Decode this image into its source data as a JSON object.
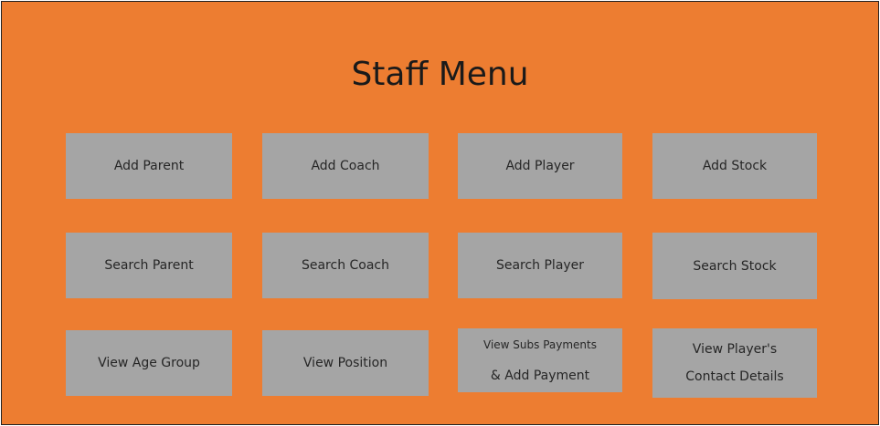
{
  "form": {
    "title": "Staff Menu",
    "background": "#ED7D31",
    "button_color": "#A5A5A5"
  },
  "buttons": {
    "add_parent": "Add Parent",
    "add_coach": "Add Coach",
    "add_player": "Add Player",
    "add_stock": "Add Stock",
    "search_parent": "Search Parent",
    "search_coach": "Search Coach",
    "search_player": "Search Player",
    "search_stock": "Search Stock",
    "view_age_group": "View Age Group",
    "view_position": "View Position",
    "view_subs_line1": "View Subs Payments",
    "view_subs_line2": "& Add Payment",
    "view_contact_line1": "View Player's",
    "view_contact_line2": "Contact Details"
  }
}
